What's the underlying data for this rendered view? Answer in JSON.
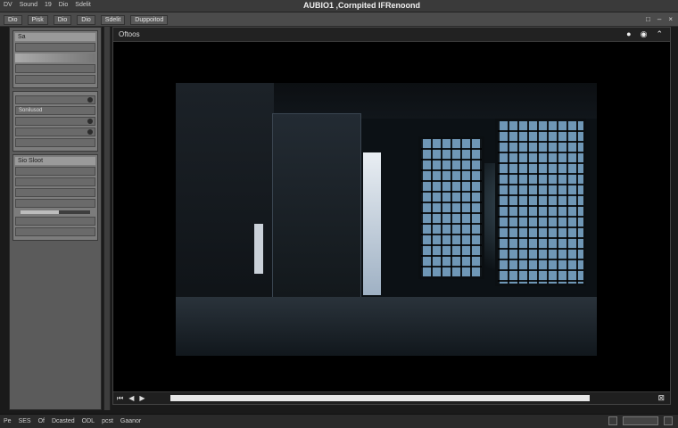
{
  "window": {
    "title": "AUBIO1 ,Cornpited IFRenoond",
    "menu": [
      "DV",
      "Sound",
      "19",
      "Dio",
      "Sdelit"
    ]
  },
  "toolbar": {
    "tools": [
      "Dio",
      "Pisk",
      "Dio",
      "Dio",
      "Sdelit",
      "Duppoitod"
    ],
    "right_icons": [
      "square-icon",
      "minus-icon",
      "close-icon"
    ]
  },
  "left_panel": {
    "section1": {
      "header": "Sa",
      "rows": [
        "",
        "",
        "",
        ""
      ]
    },
    "section2": {
      "header": "",
      "rows": [
        "Sonilusod",
        "",
        "",
        "",
        ""
      ]
    },
    "section3": {
      "header": "Sio Sloot",
      "rows": [
        "",
        "",
        "",
        "",
        "",
        ""
      ],
      "slider_value": 0.55
    }
  },
  "viewer": {
    "label": "Oftoos",
    "icons": [
      "dot-icon",
      "eye-icon",
      "chevron-icon"
    ]
  },
  "viewer_foot": {
    "nav": [
      "",
      "",
      ""
    ],
    "scroll_position": 0.0
  },
  "statusbar": {
    "items": [
      "Pe",
      "SES",
      "Of",
      "Dcasted",
      "ODL",
      "pcst",
      "Gaanor"
    ]
  }
}
